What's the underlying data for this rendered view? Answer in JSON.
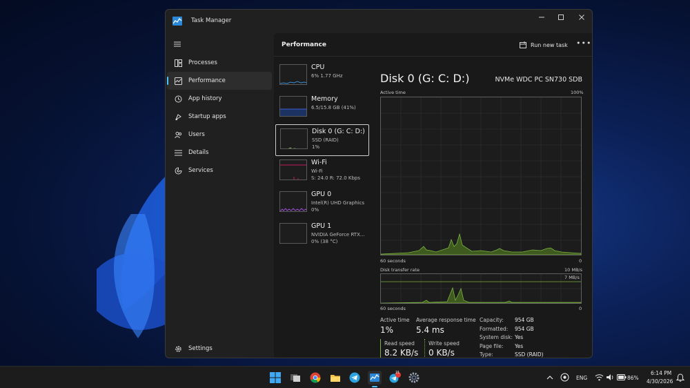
{
  "window": {
    "title": "Task Manager"
  },
  "nav": {
    "items": [
      {
        "label": "Processes",
        "icon": "processes-icon"
      },
      {
        "label": "Performance",
        "icon": "performance-icon",
        "active": true
      },
      {
        "label": "App history",
        "icon": "history-icon"
      },
      {
        "label": "Startup apps",
        "icon": "startup-icon"
      },
      {
        "label": "Users",
        "icon": "users-icon"
      },
      {
        "label": "Details",
        "icon": "details-icon"
      },
      {
        "label": "Services",
        "icon": "services-icon"
      }
    ],
    "settings_label": "Settings"
  },
  "header": {
    "title": "Performance",
    "run_task_label": "Run new task",
    "more_label": "•••"
  },
  "perf_list": [
    {
      "name": "CPU",
      "sub": "6%  1.77 GHz",
      "sub2": "",
      "color": "#3a8ed4"
    },
    {
      "name": "Memory",
      "sub": "6.5/15.8 GB (41%)",
      "sub2": "",
      "color": "#3a5fd4"
    },
    {
      "name": "Disk 0 (G: C: D:)",
      "sub": "SSD (RAID)",
      "sub2": "1%",
      "color": "#7cb342"
    },
    {
      "name": "Wi-Fi",
      "sub": "Wi-Fi",
      "sub2": "S: 24.0  R: 72.0 Kbps",
      "color": "#c2185b"
    },
    {
      "name": "GPU 0",
      "sub": "Intel(R) UHD Graphics",
      "sub2": "0%",
      "color": "#9c4fd4"
    },
    {
      "name": "GPU 1",
      "sub": "NVIDIA GeForce RTX...",
      "sub2": "0% (38 °C)",
      "color": "#9c4fd4"
    }
  ],
  "disk": {
    "title": "Disk 0 (G: C: D:)",
    "model": "NVMe WDC PC SN730 SDB",
    "active_time_label": "Active time",
    "active_time_max": "100%",
    "seconds_label": "60 seconds",
    "zero_label": "0",
    "transfer_label": "Disk transfer rate",
    "transfer_max": "10 MB/s",
    "transfer_marker": "7 MB/s",
    "accent": "#7cb342"
  },
  "stats": {
    "active_time_label": "Active time",
    "active_time_value": "1%",
    "response_label": "Average response time",
    "response_value": "5.4 ms",
    "read_label": "Read speed",
    "read_value": "8.2 KB/s",
    "write_label": "Write speed",
    "write_value": "0 KB/s",
    "details": [
      {
        "key": "Capacity:",
        "value": "954 GB"
      },
      {
        "key": "Formatted:",
        "value": "954 GB"
      },
      {
        "key": "System disk:",
        "value": "Yes"
      },
      {
        "key": "Page file:",
        "value": "Yes"
      },
      {
        "key": "Type:",
        "value": "SSD (RAID)"
      }
    ]
  },
  "taskbar": {
    "telegram_badge": "21",
    "lang": "ENG",
    "battery": "86%",
    "time": "6:14 PM",
    "date": "4/30/2026"
  }
}
